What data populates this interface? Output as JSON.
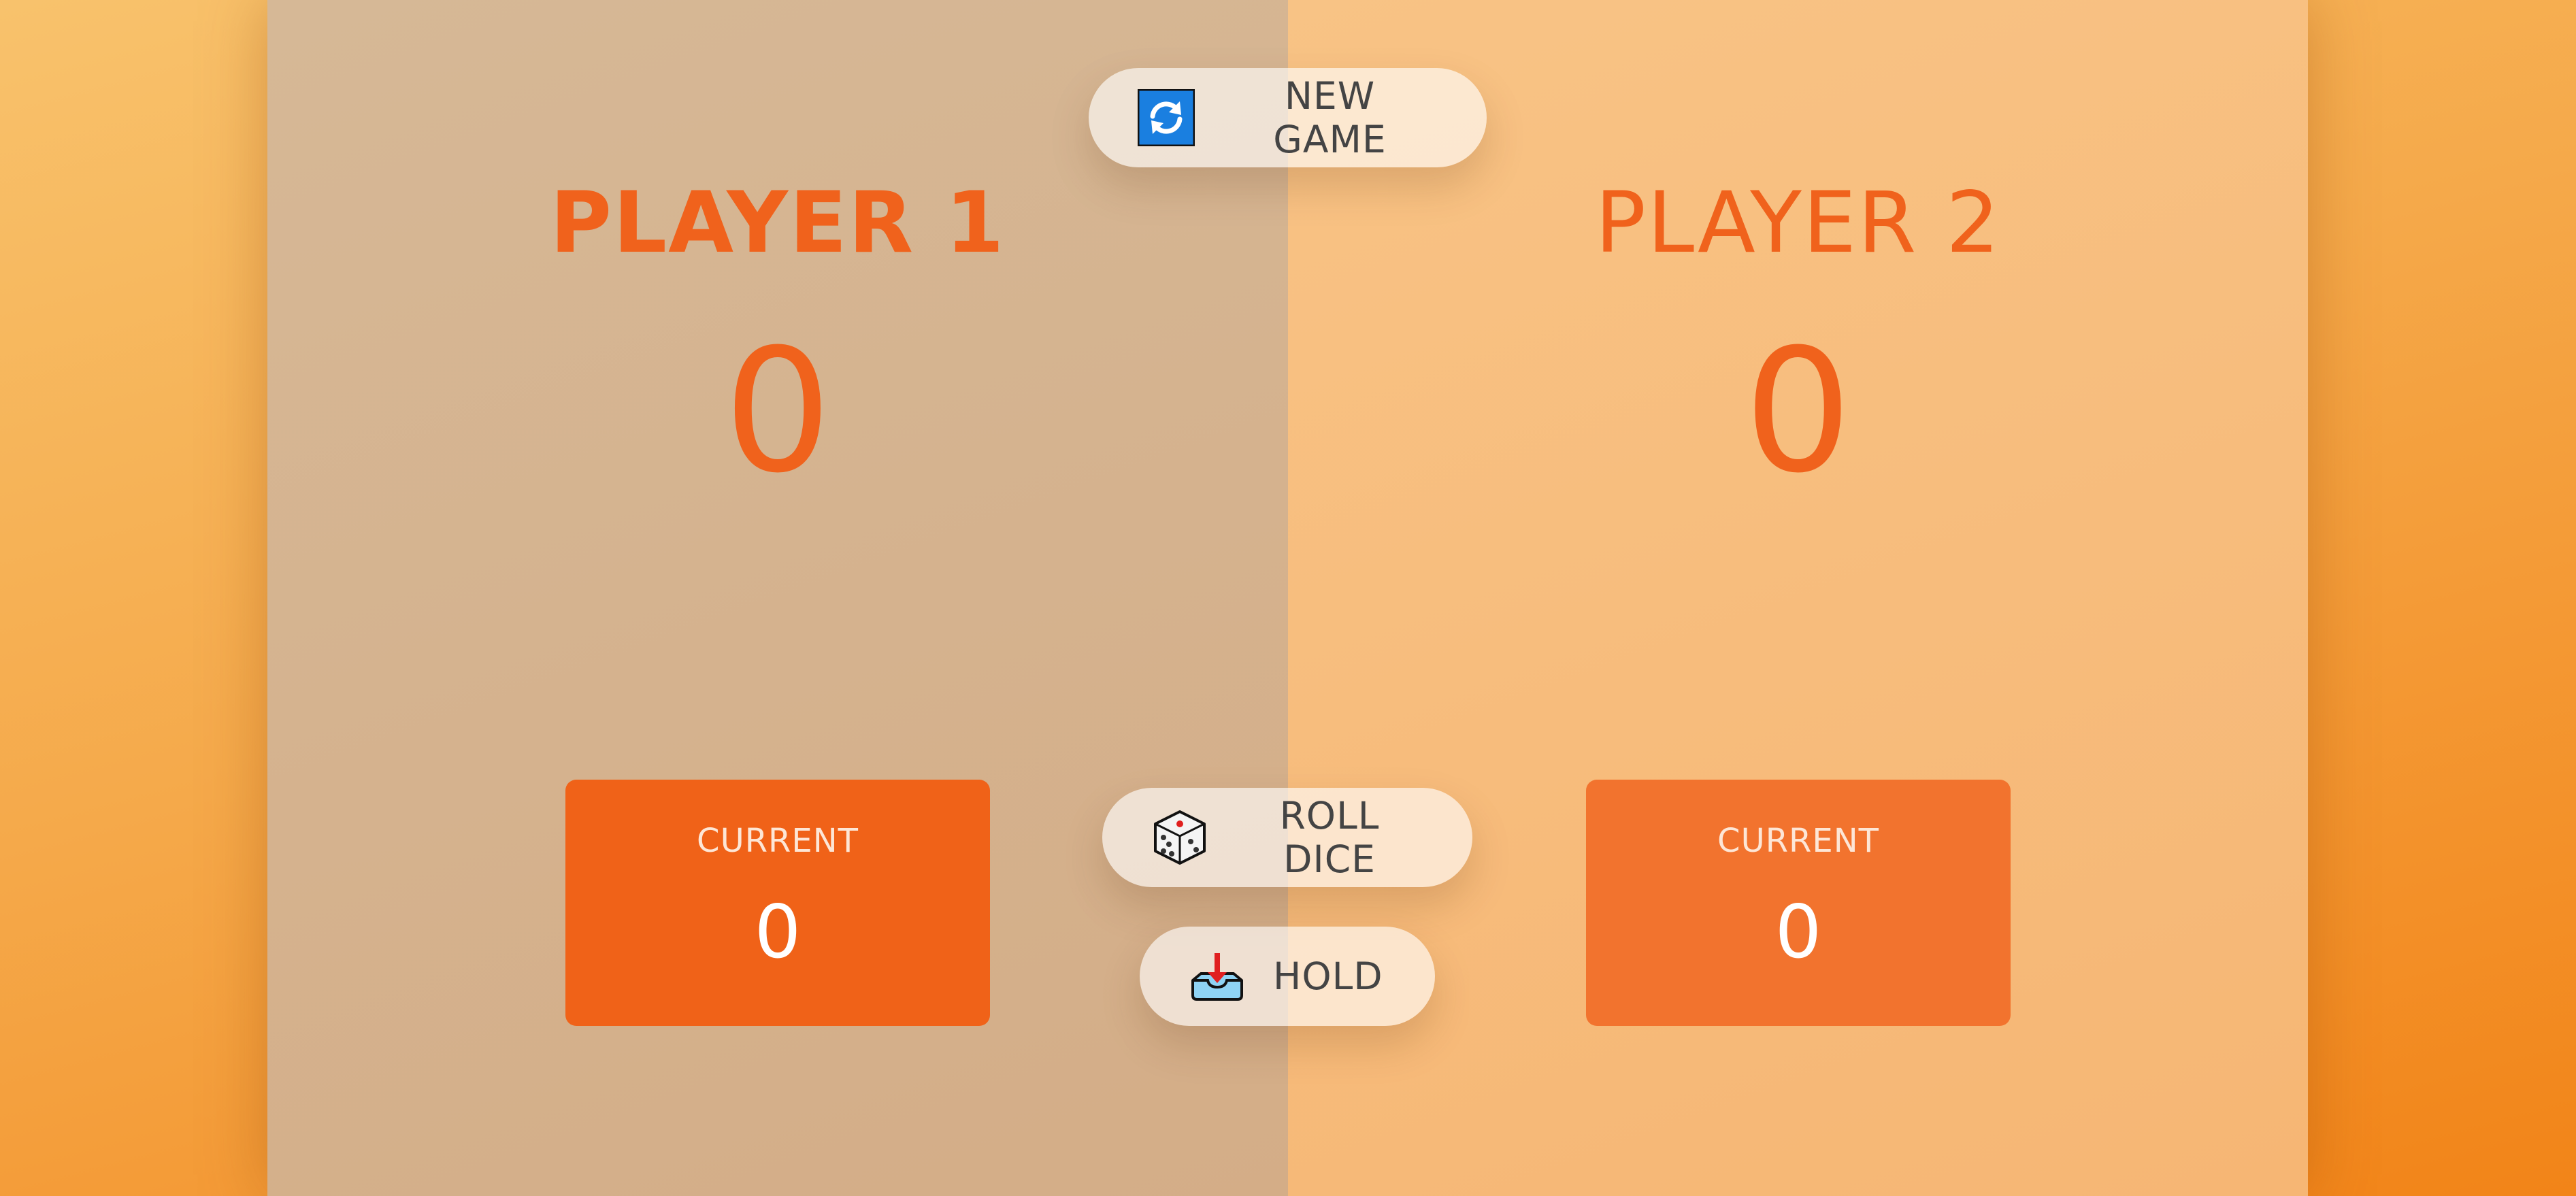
{
  "controls": {
    "new_game": {
      "label": "NEW GAME",
      "icon": "refresh-icon"
    },
    "roll_dice": {
      "label": "ROLL DICE",
      "icon": "dice-icon"
    },
    "hold": {
      "label": "HOLD",
      "icon": "inbox-tray-icon"
    }
  },
  "players": [
    {
      "name": "PLAYER 1",
      "score": "0",
      "current_label": "CURRENT",
      "current_score": "0",
      "active": true
    },
    {
      "name": "PLAYER 2",
      "score": "0",
      "current_label": "CURRENT",
      "current_score": "0",
      "active": false
    }
  ],
  "colors": {
    "accent": "#f0621c",
    "active_panel": "#d6b592",
    "inactive_panel": "#f7bc7c",
    "current_box_active": "#f06218",
    "current_box_inactive": "#f2732e"
  }
}
